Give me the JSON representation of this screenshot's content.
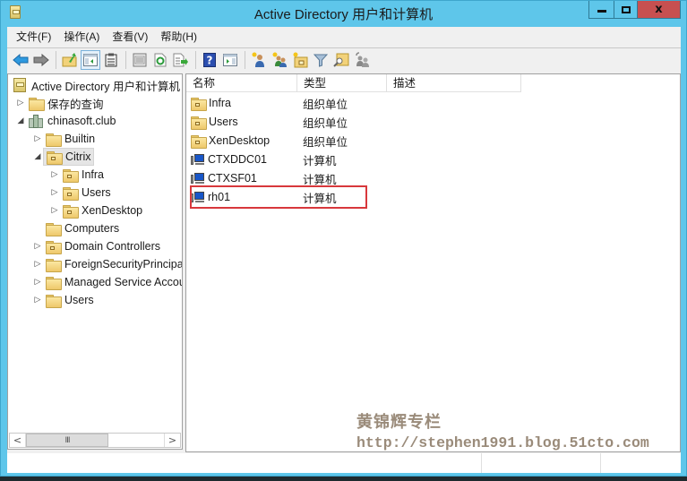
{
  "window": {
    "title": "Active Directory 用户和计算机",
    "icon": "ad-console-icon",
    "controls": {
      "minimize": "minimize-icon",
      "maximize": "maximize-icon",
      "close_glyph": "x"
    }
  },
  "menubar": {
    "items": [
      {
        "label": "文件(F)"
      },
      {
        "label": "操作(A)"
      },
      {
        "label": "查看(V)"
      },
      {
        "label": "帮助(H)"
      }
    ]
  },
  "toolbar": {
    "buttons": [
      {
        "icon": "back-arrow-icon"
      },
      {
        "icon": "forward-arrow-icon"
      },
      {
        "icon": "up-folder-icon"
      },
      {
        "icon": "show-hide-console-tree-icon",
        "active": true
      },
      {
        "icon": "clipboard-icon"
      },
      {
        "icon": "properties-icon"
      },
      {
        "icon": "refresh-icon"
      },
      {
        "icon": "export-list-icon"
      },
      {
        "icon": "help-icon"
      },
      {
        "icon": "show-action-pane-icon"
      },
      {
        "icon": "new-user-icon"
      },
      {
        "icon": "new-group-icon"
      },
      {
        "icon": "new-ou-icon"
      },
      {
        "icon": "filter-icon"
      },
      {
        "icon": "find-icon"
      },
      {
        "icon": "add-to-group-icon"
      }
    ]
  },
  "tree": {
    "root": "Active Directory 用户和计算机",
    "items": [
      {
        "label": "保存的查询",
        "level": 1,
        "expander": "collapsed",
        "icon": "folder"
      },
      {
        "label": "chinasoft.club",
        "level": 1,
        "expander": "expanded",
        "icon": "domain"
      },
      {
        "label": "Builtin",
        "level": 2,
        "expander": "collapsed",
        "icon": "folder"
      },
      {
        "label": "Citrix",
        "level": 2,
        "expander": "expanded",
        "icon": "ou",
        "selected": true
      },
      {
        "label": "Infra",
        "level": 3,
        "expander": "collapsed",
        "icon": "ou"
      },
      {
        "label": "Users",
        "level": 3,
        "expander": "collapsed",
        "icon": "ou"
      },
      {
        "label": "XenDesktop",
        "level": 3,
        "expander": "collapsed",
        "icon": "ou"
      },
      {
        "label": "Computers",
        "level": 2,
        "expander": "none",
        "icon": "folder"
      },
      {
        "label": "Domain Controllers",
        "level": 2,
        "expander": "collapsed",
        "icon": "ou"
      },
      {
        "label": "ForeignSecurityPrincipals",
        "level": 2,
        "expander": "collapsed",
        "icon": "folder"
      },
      {
        "label": "Managed Service Accounts",
        "level": 2,
        "expander": "collapsed",
        "icon": "folder"
      },
      {
        "label": "Users",
        "level": 2,
        "expander": "collapsed",
        "icon": "folder"
      }
    ],
    "scrollbar": {
      "left_arrow": "<",
      "right_arrow": ">",
      "thumb_grip": "III",
      "position_fraction": 0.0,
      "visible_fraction": 0.6
    }
  },
  "list": {
    "columns": [
      "名称",
      "类型",
      "描述"
    ],
    "rows": [
      {
        "name": "Infra",
        "type": "组织单位",
        "description": "",
        "icon": "ou"
      },
      {
        "name": "Users",
        "type": "组织单位",
        "description": "",
        "icon": "ou"
      },
      {
        "name": "XenDesktop",
        "type": "组织单位",
        "description": "",
        "icon": "ou"
      },
      {
        "name": "CTXDDC01",
        "type": "计算机",
        "description": "",
        "icon": "computer"
      },
      {
        "name": "CTXSF01",
        "type": "计算机",
        "description": "",
        "icon": "computer"
      },
      {
        "name": "rh01",
        "type": "计算机",
        "description": "",
        "icon": "computer",
        "highlighted": true
      }
    ],
    "highlight_color": "#d8383c"
  },
  "watermark": {
    "title": "黄锦辉专栏",
    "url": "http://stephen1991.blog.51cto.com"
  },
  "colors": {
    "titlebar": "#5ec6ea",
    "close_button": "#c75050",
    "highlight_box": "#d8383c"
  }
}
